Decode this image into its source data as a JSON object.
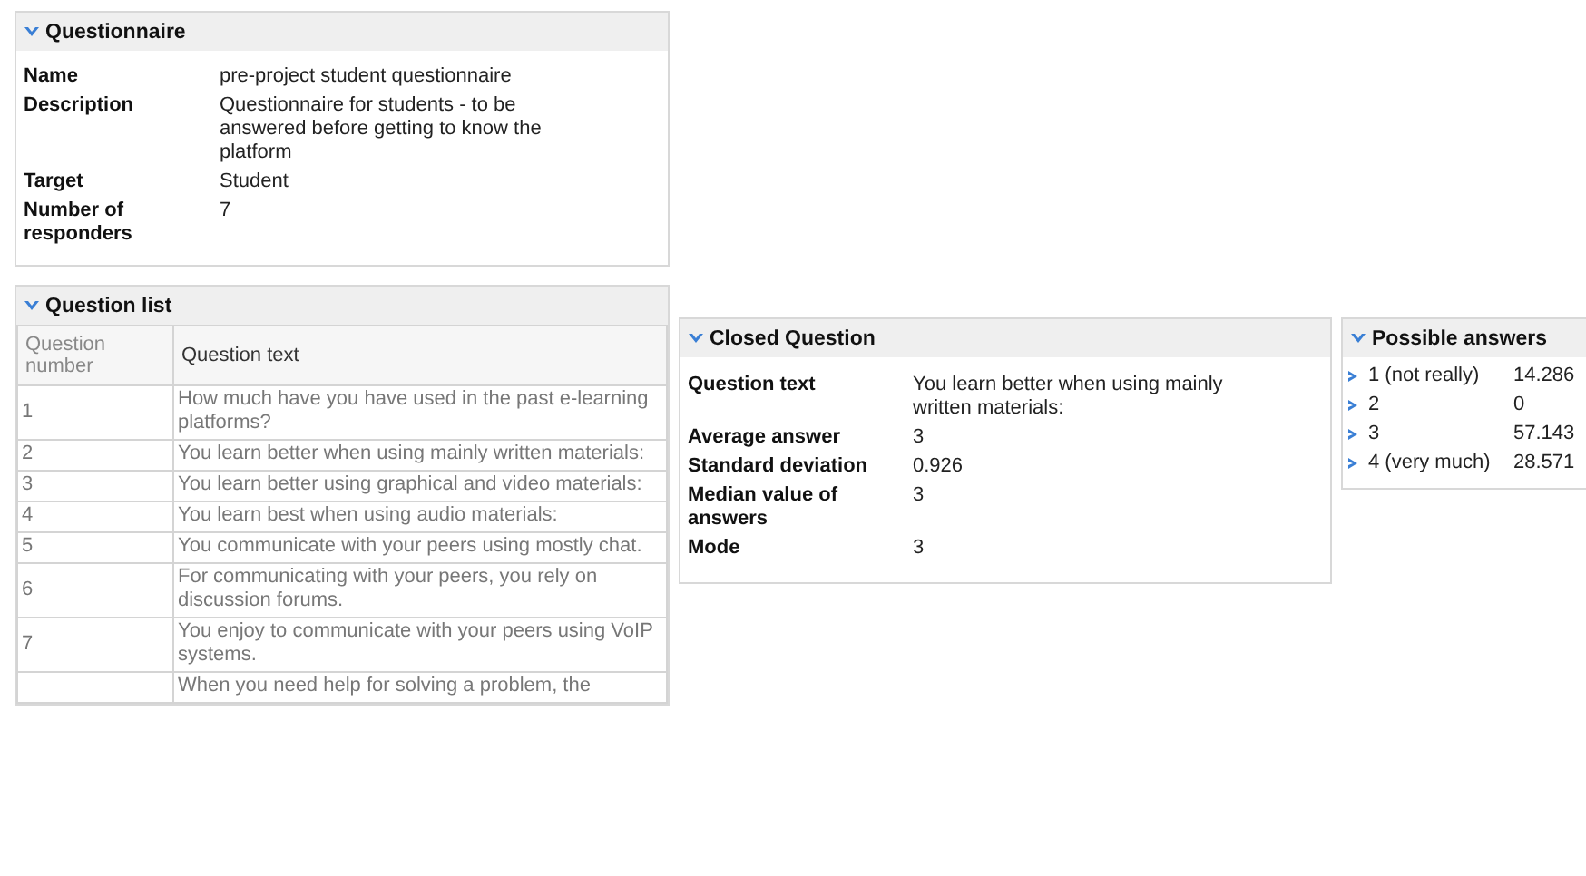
{
  "questionnaire": {
    "title": "Questionnaire",
    "expanded": true,
    "fields": [
      {
        "label": "Name",
        "value": "pre-project student questionnaire"
      },
      {
        "label": "Description",
        "value": "Questionnaire for students - to be answered before getting to know the platform"
      },
      {
        "label": "Target",
        "value": "Student"
      },
      {
        "label": "Number of responders",
        "value": "7"
      }
    ]
  },
  "question_list": {
    "title": "Question list",
    "expanded": true,
    "columns": [
      "Question number",
      "Question text"
    ],
    "rows": [
      {
        "number": "1",
        "text": "How much have you have used in the past e-learning platforms?"
      },
      {
        "number": "2",
        "text": "You learn better when using mainly written materials:"
      },
      {
        "number": "3",
        "text": "You learn better using graphical and video materials:"
      },
      {
        "number": "4",
        "text": "You learn best when using audio materials:"
      },
      {
        "number": "5",
        "text": "You communicate with your peers using mostly chat."
      },
      {
        "number": "6",
        "text": "For communicating with your peers, you rely on discussion forums."
      },
      {
        "number": "7",
        "text": "You enjoy to communicate with your peers using VoIP systems."
      },
      {
        "text": "When you need help for solving a problem, the"
      }
    ]
  },
  "closed_question": {
    "title": "Closed Question",
    "expanded": true,
    "fields": [
      {
        "label": "Question text",
        "value": "You learn better when using mainly written materials:"
      },
      {
        "label": "Average answer",
        "value": "3"
      },
      {
        "label": "Standard deviation",
        "value": "0.926"
      },
      {
        "label": "Median value of answers",
        "value": "3"
      },
      {
        "label": "Mode",
        "value": "3"
      }
    ]
  },
  "possible_answers": {
    "title": "Possible answers",
    "expanded": true,
    "items": [
      {
        "answer": "1 (not really)",
        "percent": "14.286"
      },
      {
        "answer": "2",
        "percent": "0"
      },
      {
        "answer": "3",
        "percent": "57.143"
      },
      {
        "answer": "4 (very much)",
        "percent": "28.571"
      }
    ]
  }
}
